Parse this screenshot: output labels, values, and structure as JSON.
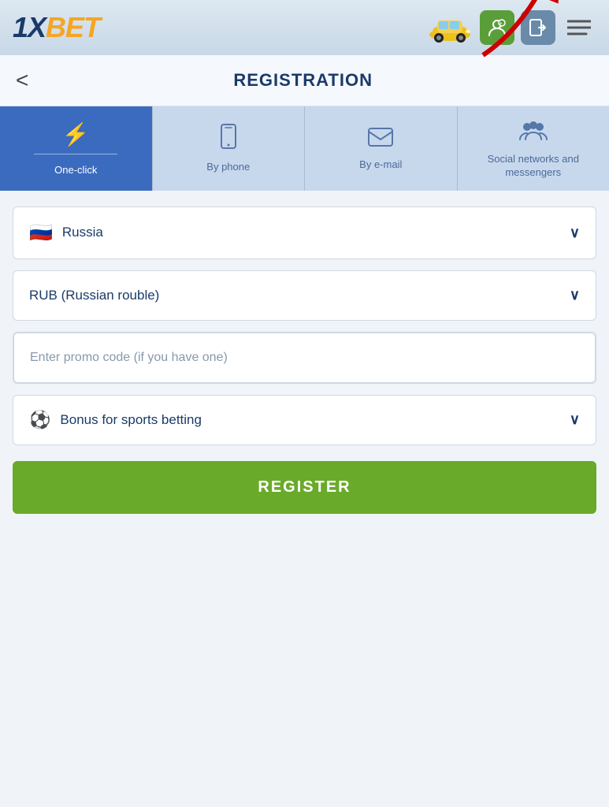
{
  "header": {
    "logo_prefix": "1X",
    "logo_suffix": "BET",
    "buttons": {
      "profile_label": "profile",
      "login_label": "login",
      "menu_label": "menu"
    }
  },
  "registration": {
    "back_label": "<",
    "title": "REGISTRATION"
  },
  "tabs": [
    {
      "id": "one-click",
      "icon": "⚡",
      "label": "One-click",
      "active": true
    },
    {
      "id": "by-phone",
      "icon": "📱",
      "label": "By phone",
      "active": false
    },
    {
      "id": "by-email",
      "icon": "✉",
      "label": "By e-mail",
      "active": false
    },
    {
      "id": "social",
      "icon": "👥",
      "label": "Social networks and messengers",
      "active": false
    }
  ],
  "form": {
    "country": {
      "flag": "🇷🇺",
      "value": "Russia"
    },
    "currency": {
      "value": "RUB (Russian rouble)"
    },
    "promo": {
      "placeholder": "Enter promo code (if you have one)"
    },
    "bonus": {
      "icon": "⚽",
      "label": "Bonus for sports betting"
    },
    "register_btn": "REGISTER"
  }
}
